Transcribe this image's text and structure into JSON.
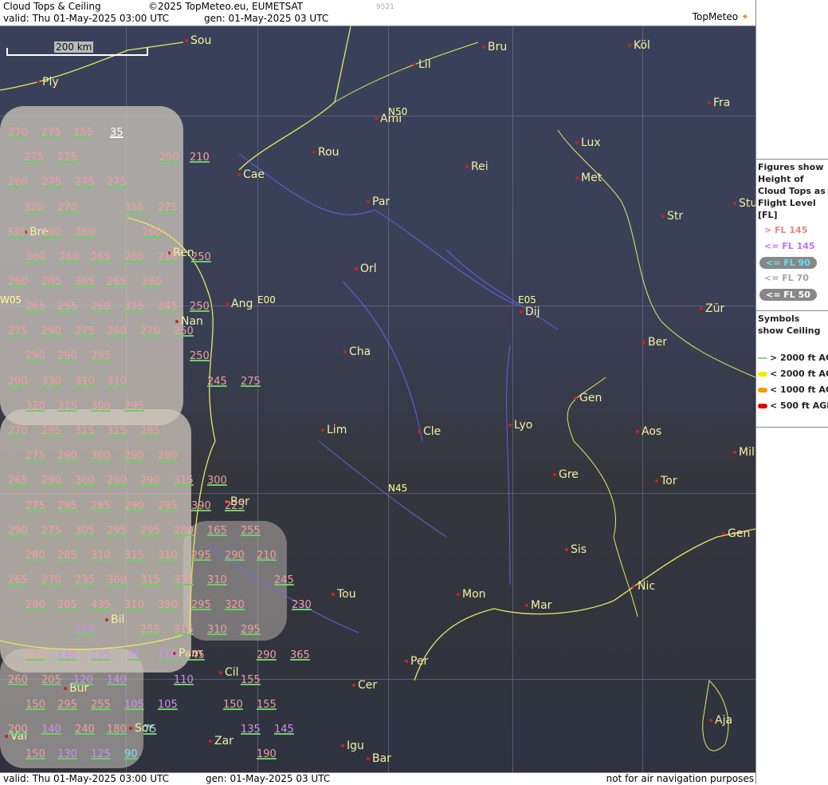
{
  "header": {
    "title": "Cloud Tops & Ceiling",
    "copyright": "©2025 TopMeteo.eu, EUMETSAT",
    "code": "9521",
    "valid": "valid:  Thu  01-May-2025  03:00 UTC",
    "gen": "gen: 01-May-2025 03 UTC",
    "logo": "TopMeteo"
  },
  "scale_label": "200 km",
  "footer": {
    "valid": "valid:  Thu  01-May-2025  03:00 UTC",
    "gen": "gen: 01-May-2025 03 UTC",
    "disclaimer": "not for air navigation purposes"
  },
  "legend": {
    "tops_title": "Figures show Height of Cloud Tops as Flight Level [FL]",
    "tops": [
      {
        "label": "> FL 145",
        "color": "#f08080"
      },
      {
        "label": "<= FL 145",
        "color": "#c070f0"
      },
      {
        "label": "<= FL 90",
        "color": "#60e0f0"
      },
      {
        "label": "<= FL 70",
        "color": "#a0a0a0"
      },
      {
        "label": "<= FL 50",
        "color": "#ffffff"
      }
    ],
    "ceiling_title": "Symbols show Ceiling",
    "ceiling": [
      {
        "label": "> 2000 ft AGL",
        "color": "#80e080"
      },
      {
        "label": "< 2000 ft AGL",
        "color": "#f0f000"
      },
      {
        "label": "< 1000 ft AGL",
        "color": "#f0a000"
      },
      {
        "label": "< 500 ft AGL",
        "color": "#e00000"
      }
    ]
  },
  "grid_labels": [
    "N50",
    "N45",
    "E00",
    "E05",
    "W05"
  ],
  "cities": [
    "Sou",
    "Köl",
    "Bru",
    "Lil",
    "Ply",
    "Ami",
    "Fra",
    "Lux",
    "Rou",
    "Cae",
    "Rei",
    "Met",
    "Par",
    "Stu",
    "Str",
    "Bre",
    "Ren",
    "Orl",
    "Nan",
    "Ang",
    "Dij",
    "Zür",
    "Ber",
    "Cha",
    "Gen",
    "Lim",
    "Cle",
    "Lyo",
    "Aos",
    "Mil",
    "Gre",
    "Tor",
    "Bor",
    "Gen",
    "Sis",
    "Nic",
    "Tou",
    "Mon",
    "Mar",
    "Bil",
    "Pam",
    "Per",
    "Cil",
    "Bur",
    "Cer",
    "Sor",
    "Aja",
    "Val",
    "Zar",
    "Igu",
    "Bar"
  ],
  "flight_levels": [
    "270",
    "275",
    "155",
    "35",
    "275",
    "275",
    "250",
    "210",
    "260",
    "275",
    "275",
    "275",
    "320",
    "270",
    "355",
    "275",
    "335",
    "260",
    "260",
    "260",
    "360",
    "260",
    "265",
    "260",
    "210",
    "250",
    "260",
    "205",
    "305",
    "265",
    "260",
    "265",
    "255",
    "260",
    "315",
    "245",
    "250",
    "275",
    "290",
    "275",
    "260",
    "270",
    "250",
    "290",
    "290",
    "295",
    "250",
    "290",
    "330",
    "310",
    "310",
    "245",
    "275",
    "320",
    "315",
    "300",
    "295",
    "270",
    "295",
    "315",
    "315",
    "285",
    "275",
    "290",
    "300",
    "290",
    "280",
    "265",
    "290",
    "300",
    "290",
    "290",
    "315",
    "300",
    "275",
    "295",
    "285",
    "290",
    "295",
    "390",
    "225",
    "290",
    "275",
    "305",
    "295",
    "295",
    "280",
    "165",
    "255",
    "280",
    "285",
    "310",
    "315",
    "310",
    "295",
    "290",
    "210",
    "265",
    "270",
    "235",
    "300",
    "315",
    "335",
    "310",
    "245",
    "290",
    "205",
    "435",
    "310",
    "350",
    "295",
    "320",
    "230",
    "125",
    "255",
    "315",
    "310",
    "295",
    "225",
    "140",
    "135",
    "95",
    "110",
    "245",
    "290",
    "365",
    "260",
    "205",
    "120",
    "140",
    "110",
    "155",
    "150",
    "295",
    "255",
    "105",
    "105",
    "150",
    "155",
    "200",
    "140",
    "240",
    "180",
    "75",
    "135",
    "145",
    "150",
    "130",
    "125",
    "90",
    "190"
  ]
}
